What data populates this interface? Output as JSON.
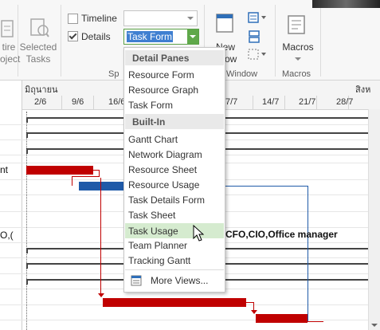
{
  "ribbon": {
    "partial_left_label_1": "tire",
    "partial_left_label_2": "oject",
    "selected_tasks_line1": "Selected",
    "selected_tasks_line2": "Tasks",
    "timeline_label": "Timeline",
    "timeline_checked": false,
    "details_label": "Details",
    "details_checked": true,
    "details_value": "Task Form",
    "split_group_label": "Sp",
    "new_window_line1": "New",
    "new_window_line2": "ndow",
    "window_group_label": "Window",
    "macros_label": "Macros",
    "macros_group_label": "Macros",
    "accent_color": "#5fa84a"
  },
  "timeline": {
    "month_left": "มิถุนายน",
    "month_right": "สิงห",
    "ticks": [
      "2/6",
      "9/6",
      "16/6",
      "7/7",
      "14/7",
      "21/7",
      "28/7"
    ]
  },
  "gantt": {
    "left_text_1": "nt",
    "left_text_2": "O,(",
    "resource_label": "CFO,CIO,Office manager",
    "bar_colors": {
      "critical": "#c00000",
      "normal": "#1f5aa8"
    }
  },
  "dropdown": {
    "section_detail": "Detail Panes",
    "detail_items": [
      "Resource Form",
      "Resource Graph",
      "Task Form"
    ],
    "section_builtin": "Built-In",
    "builtin_items": [
      "Gantt Chart",
      "Network Diagram",
      "Resource Sheet",
      "Resource Usage",
      "Task Details Form",
      "Task Sheet",
      "Task Usage",
      "Team Planner",
      "Tracking Gantt"
    ],
    "hovered_item": "Task Usage",
    "more_views": "More Views..."
  }
}
